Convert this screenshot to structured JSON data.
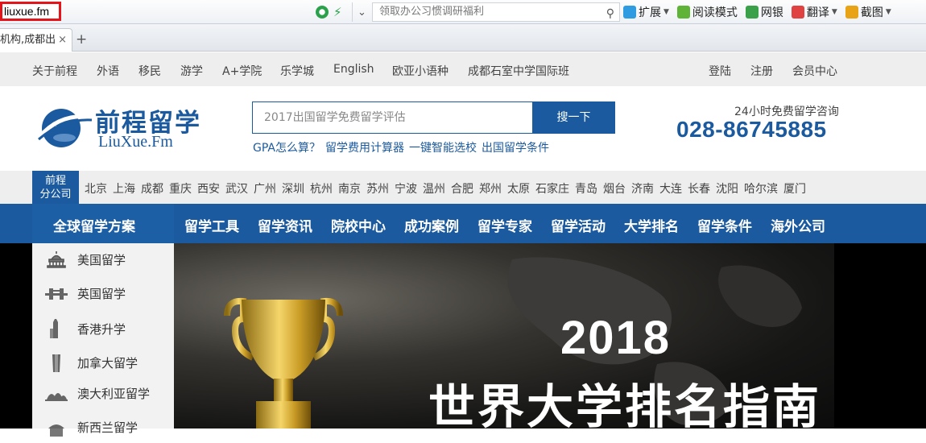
{
  "browser": {
    "url": "liuxue.fm",
    "search_placeholder": "领取办公习惯调研福利",
    "tools": [
      {
        "label": "扩展",
        "icon": "puzzle-icon",
        "color": "#2f9be0"
      },
      {
        "label": "阅读模式",
        "icon": "book-icon",
        "color": "#5fb336"
      },
      {
        "label": "网银",
        "icon": "bank-icon",
        "color": "#3aa14a"
      },
      {
        "label": "翻译",
        "icon": "translate-icon",
        "color": "#e04141"
      },
      {
        "label": "截图",
        "icon": "scissors-icon",
        "color": "#e8a317"
      }
    ],
    "tab_title": "机构,成都出国",
    "tab_close": "×",
    "new_tab": "+"
  },
  "top_links": {
    "left": [
      "关于前程",
      "外语",
      "移民",
      "游学",
      "A+学院",
      "乐学城",
      "English",
      "欧亚小语种",
      "成都石室中学国际班"
    ],
    "right": [
      "登陆",
      "注册",
      "会员中心"
    ]
  },
  "header": {
    "logo_cn": "前程留学",
    "logo_en": "LiuXue.Fm",
    "search_placeholder": "2017出国留学免费留学评估",
    "search_button": "搜一下",
    "quick_links": [
      "GPA怎么算？",
      "留学费用计算器",
      "一键智能选校",
      "出国留学条件"
    ],
    "hotline_label": "24小时免费留学咨询",
    "hotline_number": "028-86745885"
  },
  "branches": {
    "badge_line1": "前程",
    "badge_line2": "分公司",
    "cities": [
      "北京",
      "上海",
      "成都",
      "重庆",
      "西安",
      "武汉",
      "广州",
      "深圳",
      "杭州",
      "南京",
      "苏州",
      "宁波",
      "温州",
      "合肥",
      "郑州",
      "太原",
      "石家庄",
      "青岛",
      "烟台",
      "济南",
      "大连",
      "长春",
      "沈阳",
      "哈尔滨",
      "厦门"
    ]
  },
  "nav": {
    "left_label": "全球留学方案",
    "items": [
      "留学工具",
      "留学资讯",
      "院校中心",
      "成功案例",
      "留学专家",
      "留学活动",
      "大学排名",
      "留学条件",
      "海外公司"
    ]
  },
  "sidebar": {
    "items": [
      {
        "label": "美国留学",
        "icon": "capitol-icon"
      },
      {
        "label": "英国留学",
        "icon": "tower-bridge-icon"
      },
      {
        "label": "香港升学",
        "icon": "skyscraper-icon"
      },
      {
        "label": "加拿大留学",
        "icon": "cn-tower-icon"
      },
      {
        "label": "澳大利亚留学",
        "icon": "opera-house-icon"
      },
      {
        "label": "新西兰留学",
        "icon": "building-icon"
      }
    ]
  },
  "banner": {
    "year": "2018",
    "title": "世界大学排名指南"
  },
  "colors": {
    "brand_blue": "#1b5a9e",
    "url_highlight": "#e3141a"
  }
}
